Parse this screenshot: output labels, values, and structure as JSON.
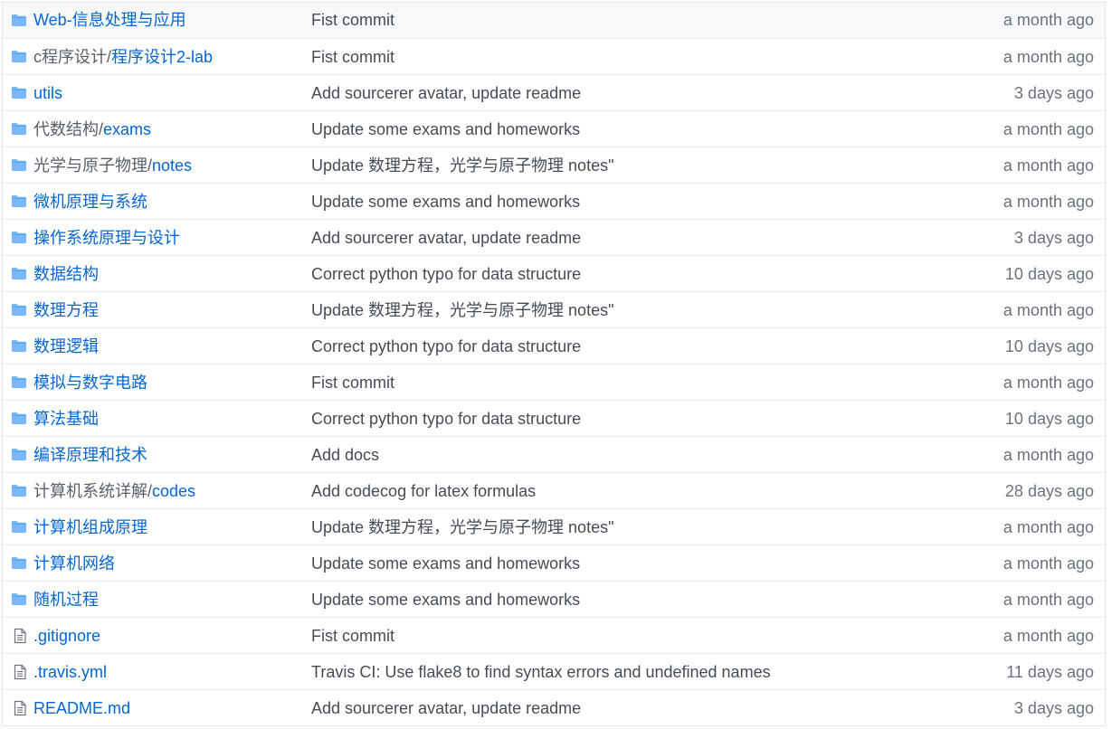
{
  "colors": {
    "link": "#0366d6",
    "folder_icon": "#79b8ff",
    "file_icon": "#6a737d",
    "text_muted": "#6a737d"
  },
  "files": [
    {
      "type": "folder",
      "icon": "folder-icon",
      "dir": "",
      "name": "Web-信息处理与应用",
      "message": "Fist commit",
      "age": "a month ago"
    },
    {
      "type": "folder",
      "icon": "folder-icon",
      "dir": "c程序设计/",
      "name": "程序设计2-lab",
      "message": "Fist commit",
      "age": "a month ago"
    },
    {
      "type": "folder",
      "icon": "folder-icon",
      "dir": "",
      "name": "utils",
      "message": "Add sourcerer avatar, update readme",
      "age": "3 days ago"
    },
    {
      "type": "folder",
      "icon": "folder-icon",
      "dir": "代数结构/",
      "name": "exams",
      "message": "Update some exams and homeworks",
      "age": "a month ago"
    },
    {
      "type": "folder",
      "icon": "folder-icon",
      "dir": "光学与原子物理/",
      "name": "notes",
      "message": "Update 数理方程，光学与原子物理 notes\"",
      "age": "a month ago"
    },
    {
      "type": "folder",
      "icon": "folder-icon",
      "dir": "",
      "name": "微机原理与系统",
      "message": "Update some exams and homeworks",
      "age": "a month ago"
    },
    {
      "type": "folder",
      "icon": "folder-icon",
      "dir": "",
      "name": "操作系统原理与设计",
      "message": "Add sourcerer avatar, update readme",
      "age": "3 days ago"
    },
    {
      "type": "folder",
      "icon": "folder-icon",
      "dir": "",
      "name": "数据结构",
      "message": "Correct python typo for data structure",
      "age": "10 days ago"
    },
    {
      "type": "folder",
      "icon": "folder-icon",
      "dir": "",
      "name": "数理方程",
      "message": "Update 数理方程，光学与原子物理 notes\"",
      "age": "a month ago"
    },
    {
      "type": "folder",
      "icon": "folder-icon",
      "dir": "",
      "name": "数理逻辑",
      "message": "Correct python typo for data structure",
      "age": "10 days ago"
    },
    {
      "type": "folder",
      "icon": "folder-icon",
      "dir": "",
      "name": "模拟与数字电路",
      "message": "Fist commit",
      "age": "a month ago"
    },
    {
      "type": "folder",
      "icon": "folder-icon",
      "dir": "",
      "name": "算法基础",
      "message": "Correct python typo for data structure",
      "age": "10 days ago"
    },
    {
      "type": "folder",
      "icon": "folder-icon",
      "dir": "",
      "name": "编译原理和技术",
      "message": "Add docs",
      "age": "a month ago"
    },
    {
      "type": "folder",
      "icon": "folder-icon",
      "dir": "计算机系统详解/",
      "name": "codes",
      "message": "Add codecog for latex formulas",
      "age": "28 days ago"
    },
    {
      "type": "folder",
      "icon": "folder-icon",
      "dir": "",
      "name": "计算机组成原理",
      "message": "Update 数理方程，光学与原子物理 notes\"",
      "age": "a month ago"
    },
    {
      "type": "folder",
      "icon": "folder-icon",
      "dir": "",
      "name": "计算机网络",
      "message": "Update some exams and homeworks",
      "age": "a month ago"
    },
    {
      "type": "folder",
      "icon": "folder-icon",
      "dir": "",
      "name": "随机过程",
      "message": "Update some exams and homeworks",
      "age": "a month ago"
    },
    {
      "type": "file",
      "icon": "file-icon",
      "dir": "",
      "name": ".gitignore",
      "message": "Fist commit",
      "age": "a month ago"
    },
    {
      "type": "file",
      "icon": "file-icon",
      "dir": "",
      "name": ".travis.yml",
      "message": "Travis CI: Use flake8 to find syntax errors and undefined names",
      "age": "11 days ago"
    },
    {
      "type": "file",
      "icon": "file-icon",
      "dir": "",
      "name": "README.md",
      "message": "Add sourcerer avatar, update readme",
      "age": "3 days ago"
    }
  ]
}
